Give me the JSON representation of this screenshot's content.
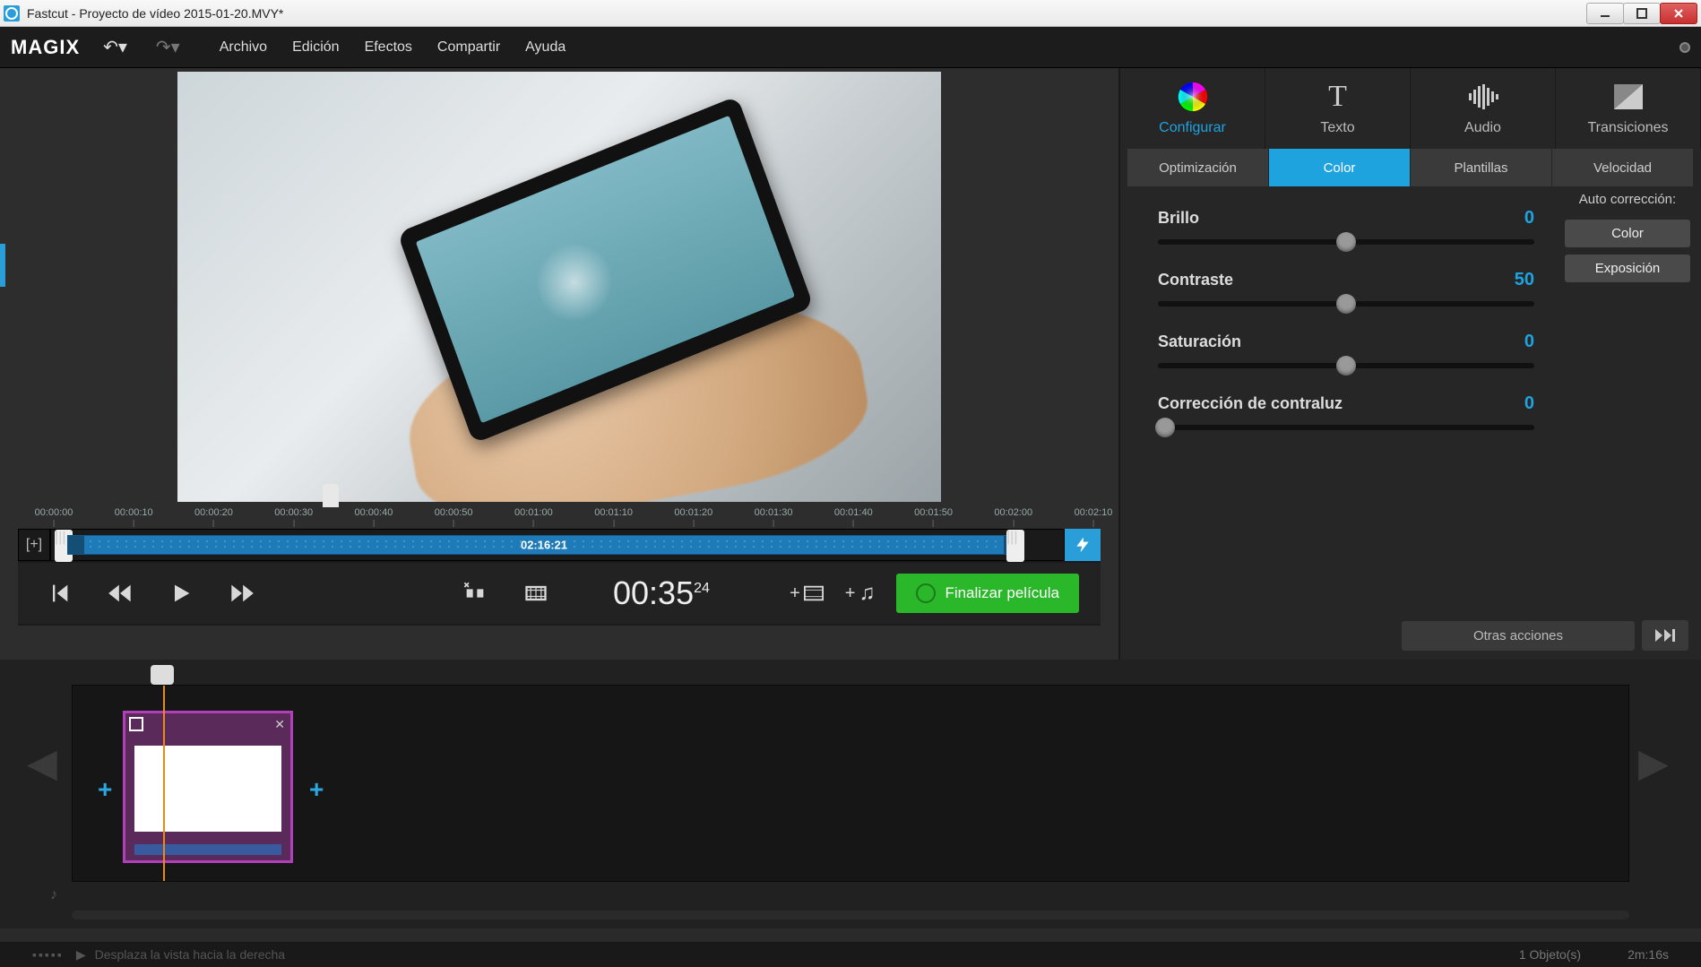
{
  "window": {
    "title": "Fastcut - Proyecto de vídeo 2015-01-20.MVY*"
  },
  "brand": "MAGIX",
  "menu": [
    "Archivo",
    "Edición",
    "Efectos",
    "Compartir",
    "Ayuda"
  ],
  "ruler_ticks": [
    "00:00:00",
    "00:00:10",
    "00:00:20",
    "00:00:30",
    "00:00:40",
    "00:00:50",
    "00:01:00",
    "00:01:10",
    "00:01:20",
    "00:01:30",
    "00:01:40",
    "00:01:50",
    "00:02:00",
    "00:02:10"
  ],
  "range": {
    "label": "02:16:21"
  },
  "transport": {
    "timecode_main": "00:35",
    "timecode_frames": "24"
  },
  "finalize": "Finalizar película",
  "right": {
    "top_tabs": [
      {
        "key": "configure",
        "label": "Configurar"
      },
      {
        "key": "text",
        "label": "Texto"
      },
      {
        "key": "audio",
        "label": "Audio"
      },
      {
        "key": "transitions",
        "label": "Transiciones"
      }
    ],
    "sub_tabs": [
      "Optimización",
      "Color",
      "Plantillas",
      "Velocidad"
    ],
    "sliders": [
      {
        "name": "Brillo",
        "value": "0",
        "pos": 50
      },
      {
        "name": "Contraste",
        "value": "50",
        "pos": 50
      },
      {
        "name": "Saturación",
        "value": "0",
        "pos": 50
      },
      {
        "name": "Corrección de contraluz",
        "value": "0",
        "pos": 2
      }
    ],
    "autocorrect": {
      "label": "Auto corrección:",
      "color": "Color",
      "exposure": "Exposición"
    },
    "other_actions": "Otras acciones"
  },
  "status": {
    "hint": "Desplaza la vista hacia la derecha",
    "objects": "1 Objeto(s)",
    "duration": "2m:16s"
  }
}
